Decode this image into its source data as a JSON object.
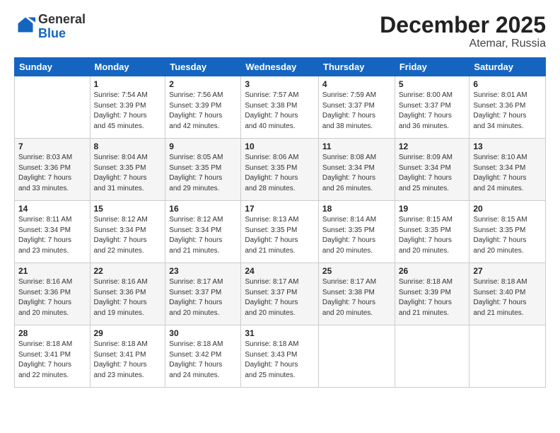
{
  "logo": {
    "general": "General",
    "blue": "Blue"
  },
  "title": "December 2025",
  "location": "Atemar, Russia",
  "days_header": [
    "Sunday",
    "Monday",
    "Tuesday",
    "Wednesday",
    "Thursday",
    "Friday",
    "Saturday"
  ],
  "weeks": [
    [
      {
        "day": "",
        "info": ""
      },
      {
        "day": "1",
        "info": "Sunrise: 7:54 AM\nSunset: 3:39 PM\nDaylight: 7 hours\nand 45 minutes."
      },
      {
        "day": "2",
        "info": "Sunrise: 7:56 AM\nSunset: 3:39 PM\nDaylight: 7 hours\nand 42 minutes."
      },
      {
        "day": "3",
        "info": "Sunrise: 7:57 AM\nSunset: 3:38 PM\nDaylight: 7 hours\nand 40 minutes."
      },
      {
        "day": "4",
        "info": "Sunrise: 7:59 AM\nSunset: 3:37 PM\nDaylight: 7 hours\nand 38 minutes."
      },
      {
        "day": "5",
        "info": "Sunrise: 8:00 AM\nSunset: 3:37 PM\nDaylight: 7 hours\nand 36 minutes."
      },
      {
        "day": "6",
        "info": "Sunrise: 8:01 AM\nSunset: 3:36 PM\nDaylight: 7 hours\nand 34 minutes."
      }
    ],
    [
      {
        "day": "7",
        "info": "Sunrise: 8:03 AM\nSunset: 3:36 PM\nDaylight: 7 hours\nand 33 minutes."
      },
      {
        "day": "8",
        "info": "Sunrise: 8:04 AM\nSunset: 3:35 PM\nDaylight: 7 hours\nand 31 minutes."
      },
      {
        "day": "9",
        "info": "Sunrise: 8:05 AM\nSunset: 3:35 PM\nDaylight: 7 hours\nand 29 minutes."
      },
      {
        "day": "10",
        "info": "Sunrise: 8:06 AM\nSunset: 3:35 PM\nDaylight: 7 hours\nand 28 minutes."
      },
      {
        "day": "11",
        "info": "Sunrise: 8:08 AM\nSunset: 3:34 PM\nDaylight: 7 hours\nand 26 minutes."
      },
      {
        "day": "12",
        "info": "Sunrise: 8:09 AM\nSunset: 3:34 PM\nDaylight: 7 hours\nand 25 minutes."
      },
      {
        "day": "13",
        "info": "Sunrise: 8:10 AM\nSunset: 3:34 PM\nDaylight: 7 hours\nand 24 minutes."
      }
    ],
    [
      {
        "day": "14",
        "info": "Sunrise: 8:11 AM\nSunset: 3:34 PM\nDaylight: 7 hours\nand 23 minutes."
      },
      {
        "day": "15",
        "info": "Sunrise: 8:12 AM\nSunset: 3:34 PM\nDaylight: 7 hours\nand 22 minutes."
      },
      {
        "day": "16",
        "info": "Sunrise: 8:12 AM\nSunset: 3:34 PM\nDaylight: 7 hours\nand 21 minutes."
      },
      {
        "day": "17",
        "info": "Sunrise: 8:13 AM\nSunset: 3:35 PM\nDaylight: 7 hours\nand 21 minutes."
      },
      {
        "day": "18",
        "info": "Sunrise: 8:14 AM\nSunset: 3:35 PM\nDaylight: 7 hours\nand 20 minutes."
      },
      {
        "day": "19",
        "info": "Sunrise: 8:15 AM\nSunset: 3:35 PM\nDaylight: 7 hours\nand 20 minutes."
      },
      {
        "day": "20",
        "info": "Sunrise: 8:15 AM\nSunset: 3:35 PM\nDaylight: 7 hours\nand 20 minutes."
      }
    ],
    [
      {
        "day": "21",
        "info": "Sunrise: 8:16 AM\nSunset: 3:36 PM\nDaylight: 7 hours\nand 20 minutes."
      },
      {
        "day": "22",
        "info": "Sunrise: 8:16 AM\nSunset: 3:36 PM\nDaylight: 7 hours\nand 19 minutes."
      },
      {
        "day": "23",
        "info": "Sunrise: 8:17 AM\nSunset: 3:37 PM\nDaylight: 7 hours\nand 20 minutes."
      },
      {
        "day": "24",
        "info": "Sunrise: 8:17 AM\nSunset: 3:37 PM\nDaylight: 7 hours\nand 20 minutes."
      },
      {
        "day": "25",
        "info": "Sunrise: 8:17 AM\nSunset: 3:38 PM\nDaylight: 7 hours\nand 20 minutes."
      },
      {
        "day": "26",
        "info": "Sunrise: 8:18 AM\nSunset: 3:39 PM\nDaylight: 7 hours\nand 21 minutes."
      },
      {
        "day": "27",
        "info": "Sunrise: 8:18 AM\nSunset: 3:40 PM\nDaylight: 7 hours\nand 21 minutes."
      }
    ],
    [
      {
        "day": "28",
        "info": "Sunrise: 8:18 AM\nSunset: 3:41 PM\nDaylight: 7 hours\nand 22 minutes."
      },
      {
        "day": "29",
        "info": "Sunrise: 8:18 AM\nSunset: 3:41 PM\nDaylight: 7 hours\nand 23 minutes."
      },
      {
        "day": "30",
        "info": "Sunrise: 8:18 AM\nSunset: 3:42 PM\nDaylight: 7 hours\nand 24 minutes."
      },
      {
        "day": "31",
        "info": "Sunrise: 8:18 AM\nSunset: 3:43 PM\nDaylight: 7 hours\nand 25 minutes."
      },
      {
        "day": "",
        "info": ""
      },
      {
        "day": "",
        "info": ""
      },
      {
        "day": "",
        "info": ""
      }
    ]
  ]
}
